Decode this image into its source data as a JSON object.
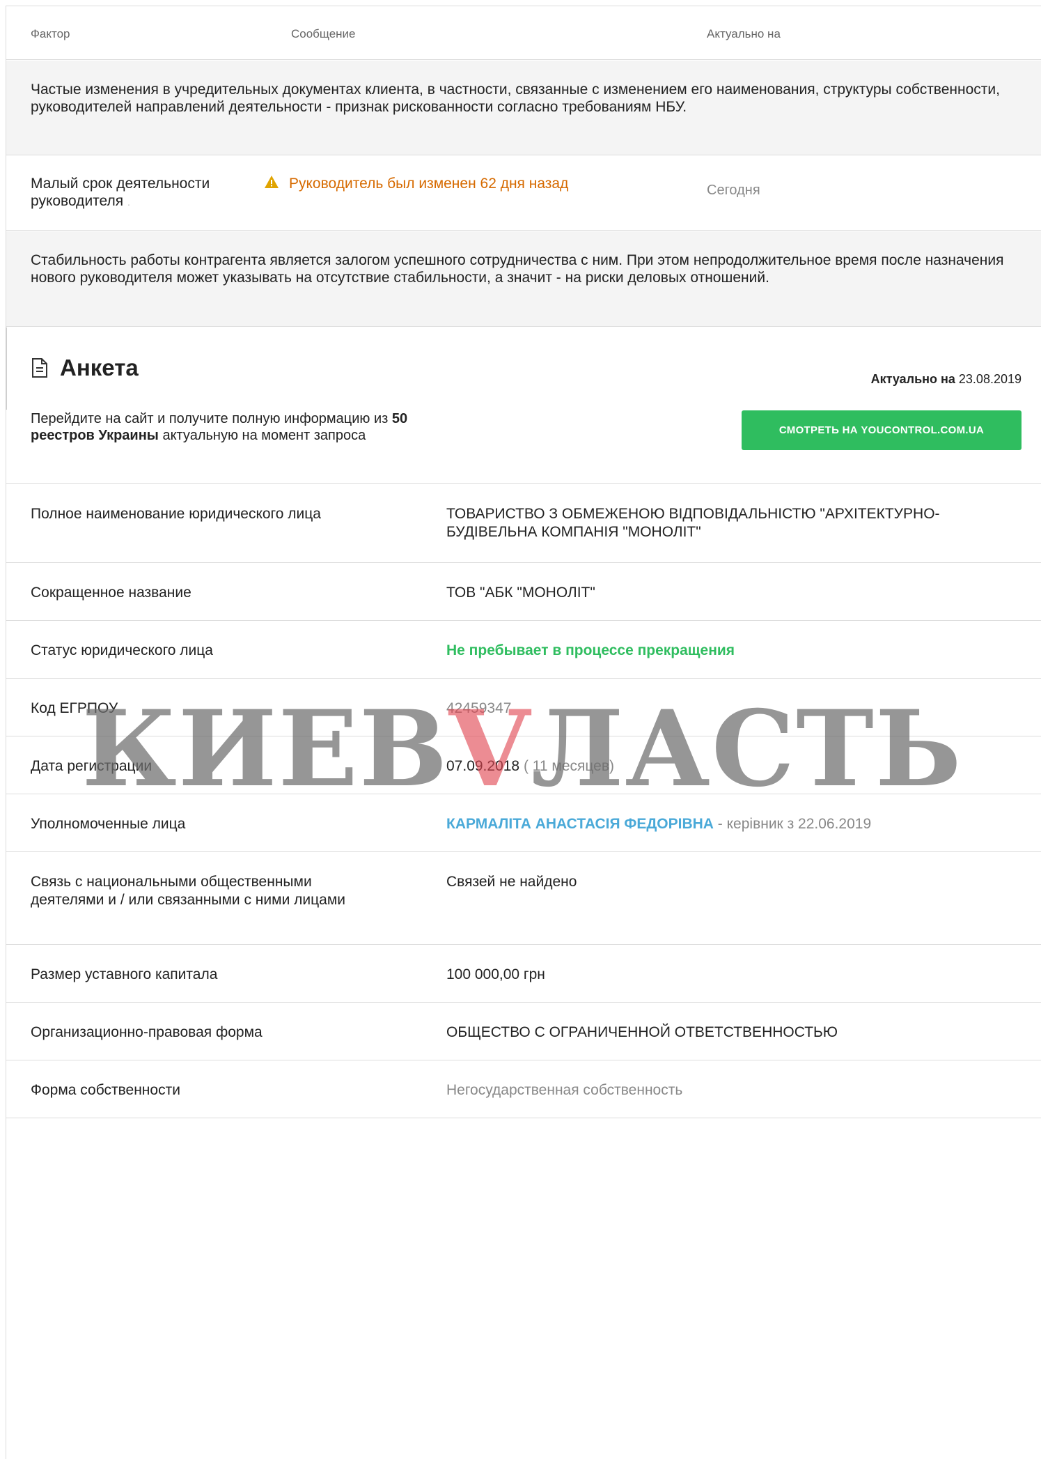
{
  "header": {
    "col_factor": "Фактор",
    "col_message": "Сообщение",
    "col_actual": "Актуально на"
  },
  "note1": "Частые изменения в учредительных документах клиента, в частности, связанные с изменением его наименования, структуры собственности, руководителей направлений деятельности - признак рискованности согласно требованиям НБУ.",
  "factor": {
    "name": "Малый срок деятельности руководителя",
    "dot": ".",
    "message": "Руководитель был изменен 62 дня назад",
    "date": "Сегодня",
    "warning_color": "#d66a00"
  },
  "note2": "Стабильность работы контрагента является залогом успешного сотрудничества с ним. При этом непродолжительное время после назначения нового руководителя может указывать на отсутствие стабильности, а значит - на риски деловых отношений.",
  "anketa": {
    "title": "Анкета",
    "actual_label": "Актуально на",
    "actual_date": "23.08.2019",
    "promo_1": "Перейдите на сайт и получите полную информацию из ",
    "promo_count": "50",
    "promo_bold": " реестров Украины",
    "promo_2": " актуальную на момент запроса",
    "button": "СМОТРЕТЬ НА YOUCONTROL.COM.UA",
    "button_color": "#2fbd5f"
  },
  "rows": {
    "full_name_label": "Полное наименование юридического лица",
    "full_name_value": "ТОВАРИСТВО З ОБМЕЖЕНОЮ ВІДПОВІДАЛЬНІСТЮ \"АРХІТЕКТУРНО-БУДІВЕЛЬНА КОМПАНІЯ \"МОНОЛІТ\"",
    "short_name_label": "Сокращенное название",
    "short_name_value": "ТОВ \"АБК \"МОНОЛІТ\"",
    "status_label": "Статус юридического лица",
    "status_value": "Не пребывает в процессе прекращения",
    "code_label": "Код ЕГРПОУ",
    "code_value": "42459347",
    "reg_label": "Дата регистрации",
    "reg_value": "07.09.2018",
    "reg_sub": " ( 11 месяцев)",
    "persons_label": "Уполномоченные лица",
    "persons_link": "КАРМАЛІТА АНАСТАСІЯ ФЕДОРІВНА",
    "persons_sub": " - керівник з 22.06.2019",
    "ties_label": "Связь с национальными общественными деятелями и / или связанными с ними лицами",
    "ties_value": "Связей не найдено",
    "capital_label": "Размер уставного капитала",
    "capital_value": "100 000,00 грн",
    "form_label": "Организационно-правовая форма",
    "form_value": "ОБЩЕСТВО С ОГРАНИЧЕННОЙ ОТВЕТСТВЕННОСТЬЮ",
    "ownership_label": "Форма собственности",
    "ownership_value": "Негосударственная собственность"
  },
  "watermark": {
    "part1": "КИЕВ",
    "part2": "V",
    "part3": "ЛАСТЬ"
  },
  "colors": {
    "green": "#2fbd5f",
    "link": "#4aa9d8",
    "gray_bg": "#f4f4f4"
  }
}
